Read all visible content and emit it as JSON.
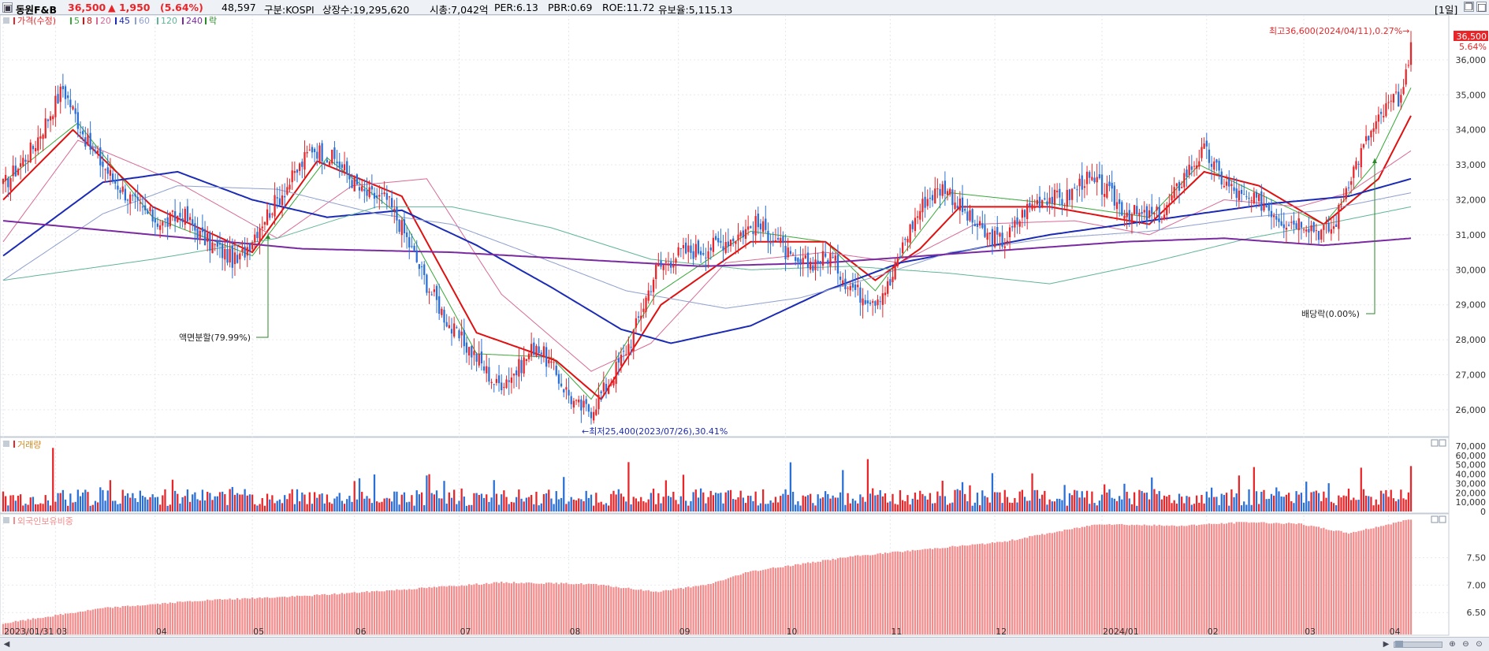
{
  "header": {
    "name": "동원F&B",
    "price": "36,500",
    "change": "▲ 1,950",
    "change_pct": "(5.64%)",
    "volume": "48,597",
    "market": "구분:KOSPI",
    "shares": "상장수:19,295,620",
    "mcap": "시총:7,042억",
    "per": "PER:6.13",
    "pbr": "PBR:0.69",
    "roe": "ROE:11.72",
    "float": "유보율:5,115.13",
    "period": "[1일]"
  },
  "legend": {
    "price": "가격(수정)",
    "ma5": "5",
    "ma8": "8",
    "ma20": "20",
    "ma45": "45",
    "ma60": "60",
    "ma120": "120",
    "ma240": "240",
    "ex": "락"
  },
  "annotations": {
    "high": "최고36,600(2024/04/11),0.27%→",
    "low": "←최저25,400(2023/07/26),30.41%",
    "split": "액면분할(79.99%)",
    "dividend": "배당락(0.00%)",
    "last_price": "36,500",
    "last_pct": "5.64%"
  },
  "panels": {
    "volume_title": "거래량",
    "foreign_title": "외국인보유비중"
  },
  "colors": {
    "up": "#e8262a",
    "down": "#2a6fd6",
    "ma5": "#38a838",
    "ma8": "#e01010",
    "ma20": "#d86a96",
    "ma45": "#1b2bb5",
    "ma60": "#8fa0d0",
    "ma120": "#5fb596",
    "ma240": "#7a2aa0",
    "foreign": "#f38c8c"
  },
  "chart_data": [
    {
      "type": "candlestick",
      "title": "동원F&B",
      "x_tick_labels": [
        "2023/01/31",
        "03",
        "04",
        "05",
        "06",
        "07",
        "08",
        "09",
        "10",
        "11",
        "12",
        "2024/01",
        "02",
        "03",
        "04"
      ],
      "y_ticks": [
        26000,
        27000,
        28000,
        29000,
        30000,
        31000,
        32000,
        33000,
        34000,
        35000,
        36000
      ],
      "ylim": [
        25300,
        37100
      ],
      "close_anchors": [
        [
          0,
          32400
        ],
        [
          12,
          33500
        ],
        [
          24,
          35200
        ],
        [
          34,
          33600
        ],
        [
          44,
          32600
        ],
        [
          54,
          31800
        ],
        [
          64,
          31300
        ],
        [
          72,
          31600
        ],
        [
          80,
          30900
        ],
        [
          86,
          30600
        ],
        [
          94,
          30200
        ],
        [
          104,
          31400
        ],
        [
          116,
          32600
        ],
        [
          124,
          33500
        ],
        [
          134,
          33100
        ],
        [
          144,
          32200
        ],
        [
          154,
          32000
        ],
        [
          160,
          31200
        ],
        [
          170,
          29600
        ],
        [
          180,
          28300
        ],
        [
          190,
          27500
        ],
        [
          198,
          26700
        ],
        [
          206,
          27100
        ],
        [
          214,
          27900
        ],
        [
          222,
          27000
        ],
        [
          230,
          26100
        ],
        [
          236,
          26000
        ],
        [
          244,
          26900
        ],
        [
          252,
          28000
        ],
        [
          262,
          30000
        ],
        [
          272,
          30500
        ],
        [
          282,
          30600
        ],
        [
          292,
          30900
        ],
        [
          302,
          31300
        ],
        [
          310,
          30900
        ],
        [
          318,
          30100
        ],
        [
          324,
          30200
        ],
        [
          332,
          30400
        ],
        [
          338,
          29700
        ],
        [
          344,
          29300
        ],
        [
          350,
          29200
        ],
        [
          356,
          29600
        ],
        [
          362,
          30900
        ],
        [
          370,
          32000
        ],
        [
          378,
          32400
        ],
        [
          386,
          31600
        ],
        [
          394,
          31000
        ],
        [
          402,
          30800
        ],
        [
          410,
          31700
        ],
        [
          418,
          32100
        ],
        [
          426,
          32000
        ],
        [
          434,
          32600
        ],
        [
          442,
          32300
        ],
        [
          450,
          31700
        ],
        [
          458,
          31500
        ],
        [
          466,
          31600
        ],
        [
          474,
          32700
        ],
        [
          482,
          33400
        ],
        [
          490,
          32500
        ],
        [
          498,
          32000
        ],
        [
          506,
          31900
        ],
        [
          514,
          31400
        ],
        [
          522,
          31400
        ],
        [
          528,
          31100
        ],
        [
          534,
          31200
        ],
        [
          540,
          32600
        ],
        [
          548,
          33800
        ],
        [
          556,
          34700
        ],
        [
          562,
          35000
        ],
        [
          565,
          36500
        ]
      ],
      "series_ma": [
        {
          "name": "5",
          "anchors": [
            [
              0,
              32500
            ],
            [
              30,
              34200
            ],
            [
              60,
              31500
            ],
            [
              100,
              30400
            ],
            [
              130,
              33200
            ],
            [
              160,
              31500
            ],
            [
              190,
              27600
            ],
            [
              220,
              27500
            ],
            [
              236,
              26300
            ],
            [
              262,
              29300
            ],
            [
              300,
              31100
            ],
            [
              330,
              30800
            ],
            [
              350,
              29400
            ],
            [
              366,
              30900
            ],
            [
              380,
              32200
            ],
            [
              420,
              31900
            ],
            [
              460,
              31500
            ],
            [
              480,
              33000
            ],
            [
              500,
              32300
            ],
            [
              530,
              31300
            ],
            [
              550,
              33000
            ],
            [
              565,
              35200
            ]
          ]
        },
        {
          "name": "8",
          "anchors": [
            [
              0,
              32000
            ],
            [
              28,
              34000
            ],
            [
              60,
              31800
            ],
            [
              100,
              30500
            ],
            [
              126,
              33100
            ],
            [
              160,
              32100
            ],
            [
              190,
              28200
            ],
            [
              222,
              27400
            ],
            [
              240,
              26300
            ],
            [
              264,
              29000
            ],
            [
              300,
              30800
            ],
            [
              330,
              30800
            ],
            [
              350,
              29700
            ],
            [
              368,
              30600
            ],
            [
              384,
              31800
            ],
            [
              420,
              31800
            ],
            [
              460,
              31300
            ],
            [
              482,
              32800
            ],
            [
              504,
              32400
            ],
            [
              530,
              31300
            ],
            [
              552,
              32600
            ],
            [
              565,
              34400
            ]
          ]
        },
        {
          "name": "20",
          "anchors": [
            [
              0,
              30800
            ],
            [
              30,
              33700
            ],
            [
              70,
              32500
            ],
            [
              110,
              30900
            ],
            [
              140,
              32400
            ],
            [
              170,
              32600
            ],
            [
              200,
              29300
            ],
            [
              236,
              27100
            ],
            [
              260,
              27900
            ],
            [
              290,
              30200
            ],
            [
              330,
              30500
            ],
            [
              360,
              30200
            ],
            [
              390,
              31300
            ],
            [
              430,
              31400
            ],
            [
              460,
              31000
            ],
            [
              490,
              32000
            ],
            [
              520,
              31800
            ],
            [
              540,
              32200
            ],
            [
              565,
              33400
            ]
          ]
        },
        {
          "name": "45",
          "anchors": [
            [
              0,
              30400
            ],
            [
              40,
              32500
            ],
            [
              70,
              32800
            ],
            [
              100,
              32000
            ],
            [
              130,
              31500
            ],
            [
              160,
              31700
            ],
            [
              190,
              30700
            ],
            [
              220,
              29500
            ],
            [
              248,
              28300
            ],
            [
              268,
              27900
            ],
            [
              300,
              28400
            ],
            [
              330,
              29400
            ],
            [
              360,
              30200
            ],
            [
              390,
              30600
            ],
            [
              420,
              31000
            ],
            [
              450,
              31300
            ],
            [
              480,
              31600
            ],
            [
              510,
              31900
            ],
            [
              540,
              32100
            ],
            [
              565,
              32600
            ]
          ]
        },
        {
          "name": "60",
          "anchors": [
            [
              0,
              29700
            ],
            [
              40,
              31600
            ],
            [
              70,
              32400
            ],
            [
              110,
              32300
            ],
            [
              150,
              31600
            ],
            [
              180,
              31300
            ],
            [
              210,
              30500
            ],
            [
              250,
              29400
            ],
            [
              290,
              28900
            ],
            [
              320,
              29200
            ],
            [
              350,
              29800
            ],
            [
              380,
              30500
            ],
            [
              420,
              30900
            ],
            [
              460,
              31100
            ],
            [
              500,
              31500
            ],
            [
              530,
              31700
            ],
            [
              565,
              32200
            ]
          ]
        },
        {
          "name": "120",
          "anchors": [
            [
              0,
              29700
            ],
            [
              60,
              30300
            ],
            [
              110,
              30900
            ],
            [
              150,
              31800
            ],
            [
              180,
              31800
            ],
            [
              220,
              31200
            ],
            [
              260,
              30300
            ],
            [
              300,
              30000
            ],
            [
              340,
              30100
            ],
            [
              380,
              29900
            ],
            [
              420,
              29600
            ],
            [
              460,
              30200
            ],
            [
              500,
              30900
            ],
            [
              530,
              31300
            ],
            [
              565,
              31800
            ]
          ]
        },
        {
          "name": "240",
          "anchors": [
            [
              0,
              31400
            ],
            [
              60,
              31000
            ],
            [
              120,
              30600
            ],
            [
              180,
              30500
            ],
            [
              230,
              30300
            ],
            [
              280,
              30100
            ],
            [
              330,
              30200
            ],
            [
              370,
              30400
            ],
            [
              410,
              30600
            ],
            [
              450,
              30800
            ],
            [
              490,
              30900
            ],
            [
              530,
              30700
            ],
            [
              565,
              30900
            ]
          ]
        }
      ],
      "annotations_points": [
        {
          "label": "최고",
          "date": "2024/04/11",
          "value": 36600
        },
        {
          "label": "최저",
          "date": "2023/07/26",
          "value": 25400
        },
        {
          "label": "액면분할",
          "value_pct": 79.99
        },
        {
          "label": "배당락",
          "value_pct": 0.0
        }
      ]
    },
    {
      "type": "bar",
      "title": "거래량",
      "y_ticks": [
        0,
        10000,
        20000,
        30000,
        40000,
        50000,
        60000,
        70000
      ],
      "ylim": [
        0,
        75000
      ]
    },
    {
      "type": "bar",
      "title": "외국인보유비중",
      "y_ticks": [
        6.5,
        7.0,
        7.5
      ],
      "ylim": [
        6.1,
        8.2
      ],
      "anchors": [
        [
          0,
          6.3
        ],
        [
          40,
          6.58
        ],
        [
          80,
          6.72
        ],
        [
          120,
          6.8
        ],
        [
          160,
          6.92
        ],
        [
          200,
          7.05
        ],
        [
          236,
          7.02
        ],
        [
          262,
          6.88
        ],
        [
          282,
          7.0
        ],
        [
          300,
          7.25
        ],
        [
          340,
          7.52
        ],
        [
          380,
          7.7
        ],
        [
          400,
          7.78
        ],
        [
          440,
          8.12
        ],
        [
          470,
          8.08
        ],
        [
          500,
          8.15
        ],
        [
          520,
          8.12
        ],
        [
          540,
          7.95
        ],
        [
          565,
          8.2
        ]
      ]
    }
  ]
}
